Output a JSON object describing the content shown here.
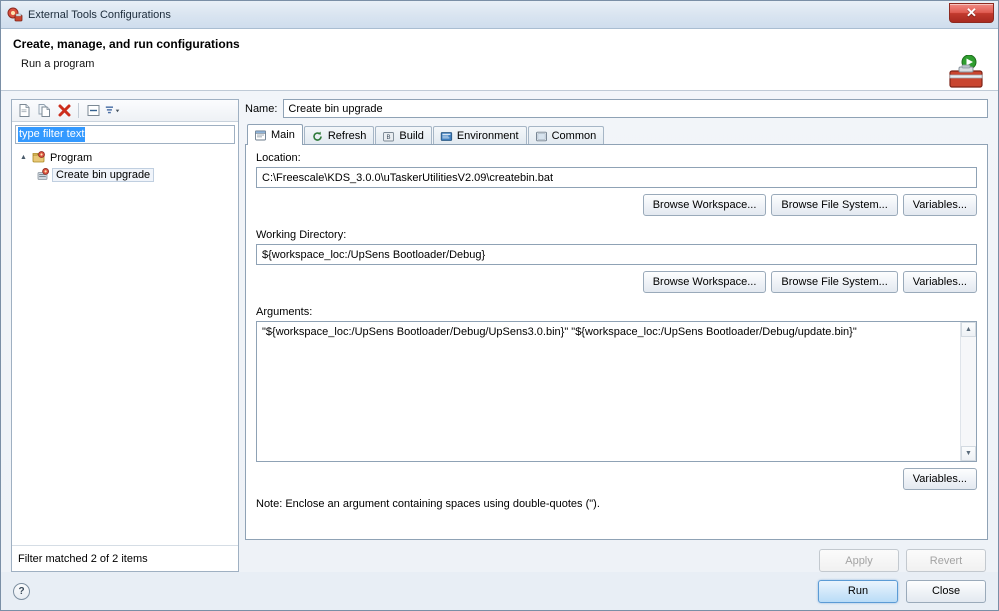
{
  "window": {
    "title": "External Tools Configurations",
    "title_icon": "external-tools-icon",
    "close_glyph": "✕"
  },
  "header": {
    "title": "Create, manage, and run configurations",
    "subtitle": "Run a program",
    "art_icon": "toolbox-run-icon"
  },
  "left_panel": {
    "toolbar": [
      {
        "name": "new-configuration-button",
        "icon": "new-doc-icon"
      },
      {
        "name": "duplicate-configuration-button",
        "icon": "copy-doc-icon"
      },
      {
        "name": "delete-configuration-button",
        "icon": "red-x-icon"
      },
      {
        "name": "collapse-all-button",
        "icon": "collapse-all-icon"
      },
      {
        "name": "filter-button",
        "icon": "filter-arrow-icon"
      }
    ],
    "filter": {
      "value": "type filter text",
      "placeholder": "type filter text",
      "selected": true
    },
    "tree": [
      {
        "label": "Program",
        "icon": "program-folder-icon",
        "expanded": true,
        "level": 0,
        "selected": false
      },
      {
        "label": "Create bin upgrade",
        "icon": "program-config-icon",
        "level": 1,
        "selected": true
      }
    ],
    "status": "Filter matched 2 of 2 items"
  },
  "right_panel": {
    "name": {
      "label": "Name:",
      "value": "Create bin upgrade"
    },
    "tabs": [
      {
        "label": "Main",
        "icon": "main-tab-icon",
        "active": true
      },
      {
        "label": "Refresh",
        "icon": "refresh-tab-icon",
        "active": false
      },
      {
        "label": "Build",
        "icon": "build-tab-icon",
        "active": false
      },
      {
        "label": "Environment",
        "icon": "environment-tab-icon",
        "active": false
      },
      {
        "label": "Common",
        "icon": "common-tab-icon",
        "active": false
      }
    ],
    "location": {
      "label": "Location:",
      "value": "C:\\Freescale\\KDS_3.0.0\\uTaskerUtilitiesV2.09\\createbin.bat",
      "buttons": [
        "Browse Workspace...",
        "Browse File System...",
        "Variables..."
      ]
    },
    "working_directory": {
      "label": "Working Directory:",
      "value": "${workspace_loc:/UpSens Bootloader/Debug}",
      "buttons": [
        "Browse Workspace...",
        "Browse File System...",
        "Variables..."
      ]
    },
    "arguments": {
      "label": "Arguments:",
      "value": "\"${workspace_loc:/UpSens Bootloader/Debug/UpSens3.0.bin}\" \"${workspace_loc:/UpSens Bootloader/Debug/update.bin}\"",
      "variables_button": "Variables...",
      "note": "Note: Enclose an argument containing spaces using double-quotes (\")."
    },
    "apply_button": {
      "label": "Apply",
      "enabled": false
    },
    "revert_button": {
      "label": "Revert",
      "enabled": false
    }
  },
  "footer": {
    "help_glyph": "?",
    "run_button": "Run",
    "close_button": "Close"
  },
  "colors": {
    "accent": "#3399ff",
    "close_red": "#c13a2e",
    "run_green": "#2f9e2f",
    "panel_border": "#8fa2b5"
  }
}
